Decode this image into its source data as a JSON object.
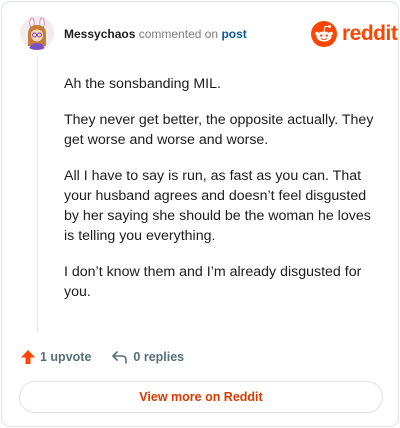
{
  "header": {
    "username": "Messychaos",
    "action_text": "commented on",
    "target_link": "post"
  },
  "logo": {
    "text": "reddit",
    "color": "#ff4500"
  },
  "comment": {
    "paragraphs": [
      "Ah the sonsbanding MIL.",
      "They never get better, the opposite actually. They get worse and worse and worse.",
      "All I have to say is run, as fast as you can. That your husband agrees and doesn’t feel disgusted by her saying she should be the woman he loves is telling you everything.",
      "I don’t know them and I’m already disgusted for you."
    ]
  },
  "actions": {
    "upvote_label": "1 upvote",
    "replies_label": "0 replies"
  },
  "view_button": {
    "label": "View more on Reddit"
  },
  "icons": {
    "avatar": "avatar-icon",
    "logo": "reddit-snoo-icon",
    "upvote": "upvote-arrow-icon",
    "reply": "reply-arrow-icon"
  }
}
